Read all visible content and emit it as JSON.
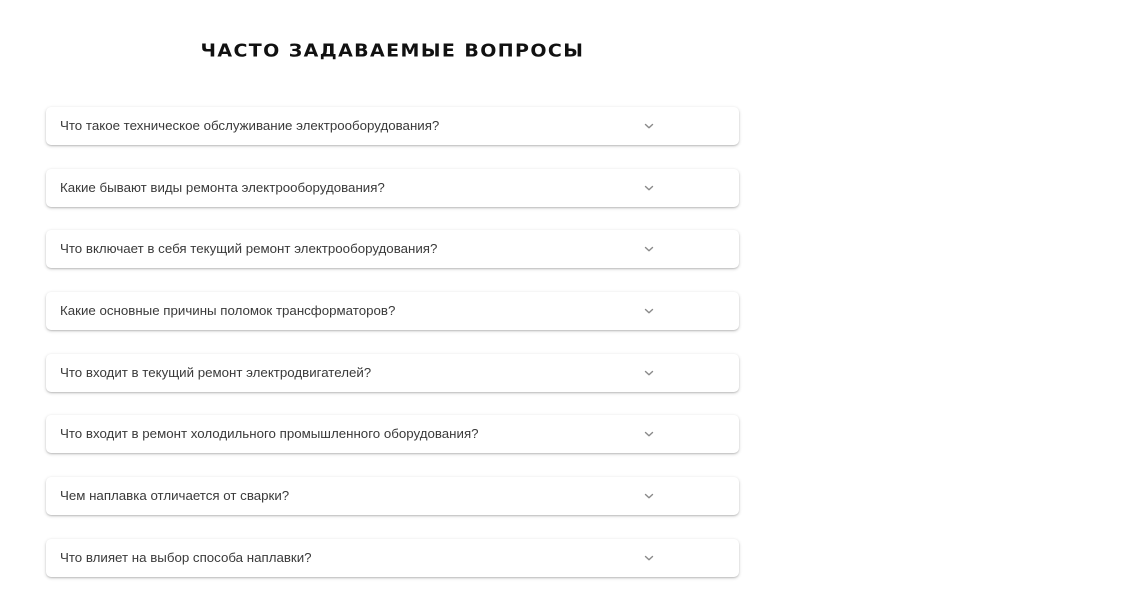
{
  "faq": {
    "title": "ЧАСТО ЗАДАВАЕМЫЕ ВОПРОСЫ",
    "expand_icon": "chevron-down-icon",
    "items": [
      {
        "question": "Что такое техническое обслуживание электрооборудования?"
      },
      {
        "question": "Какие бывают виды ремонта электрооборудования?"
      },
      {
        "question": "Что включает в себя текущий ремонт электрооборудования?"
      },
      {
        "question": "Какие основные причины поломок трансформаторов?"
      },
      {
        "question": "Что входит в текущий ремонт электродвигателей?"
      },
      {
        "question": "Что входит в ремонт холодильного промышленного оборудования?"
      },
      {
        "question": "Чем наплавка отличается от сварки?"
      },
      {
        "question": "Что влияет на выбор способа наплавки?"
      }
    ]
  },
  "colors": {
    "background": "#ffffff",
    "title": "#111111",
    "question_text": "#3a3a3a",
    "chevron": "#8a8a8a"
  }
}
